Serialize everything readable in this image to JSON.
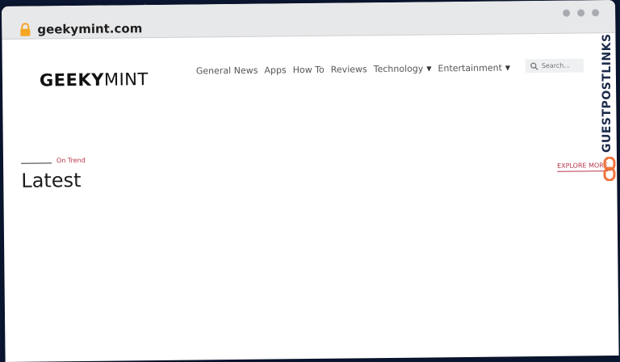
{
  "browser": {
    "url": "geekymint.com",
    "icons": {
      "lock": "lock-icon",
      "window_controls": [
        "dot",
        "dot",
        "dot"
      ]
    }
  },
  "header": {
    "logo": {
      "bold": "GEEKY",
      "light": "MINT"
    },
    "nav": [
      {
        "label": "General News",
        "dropdown": false
      },
      {
        "label": "Apps",
        "dropdown": false
      },
      {
        "label": "How To",
        "dropdown": false
      },
      {
        "label": "Reviews",
        "dropdown": false
      },
      {
        "label": "Technology",
        "dropdown": true
      },
      {
        "label": "Entertainment",
        "dropdown": true
      }
    ],
    "search": {
      "placeholder": "Search..."
    }
  },
  "main": {
    "section_tag": "On Trend",
    "section_title": "Latest",
    "explore_label": "EXPLORE MORE"
  },
  "watermark": {
    "text": "GUESTPOSTLINKS",
    "icon": "chain-link-icon"
  },
  "colors": {
    "accent": "#b8364a",
    "watermark_text": "#1b2a4a",
    "watermark_icon": "#f0733a"
  }
}
